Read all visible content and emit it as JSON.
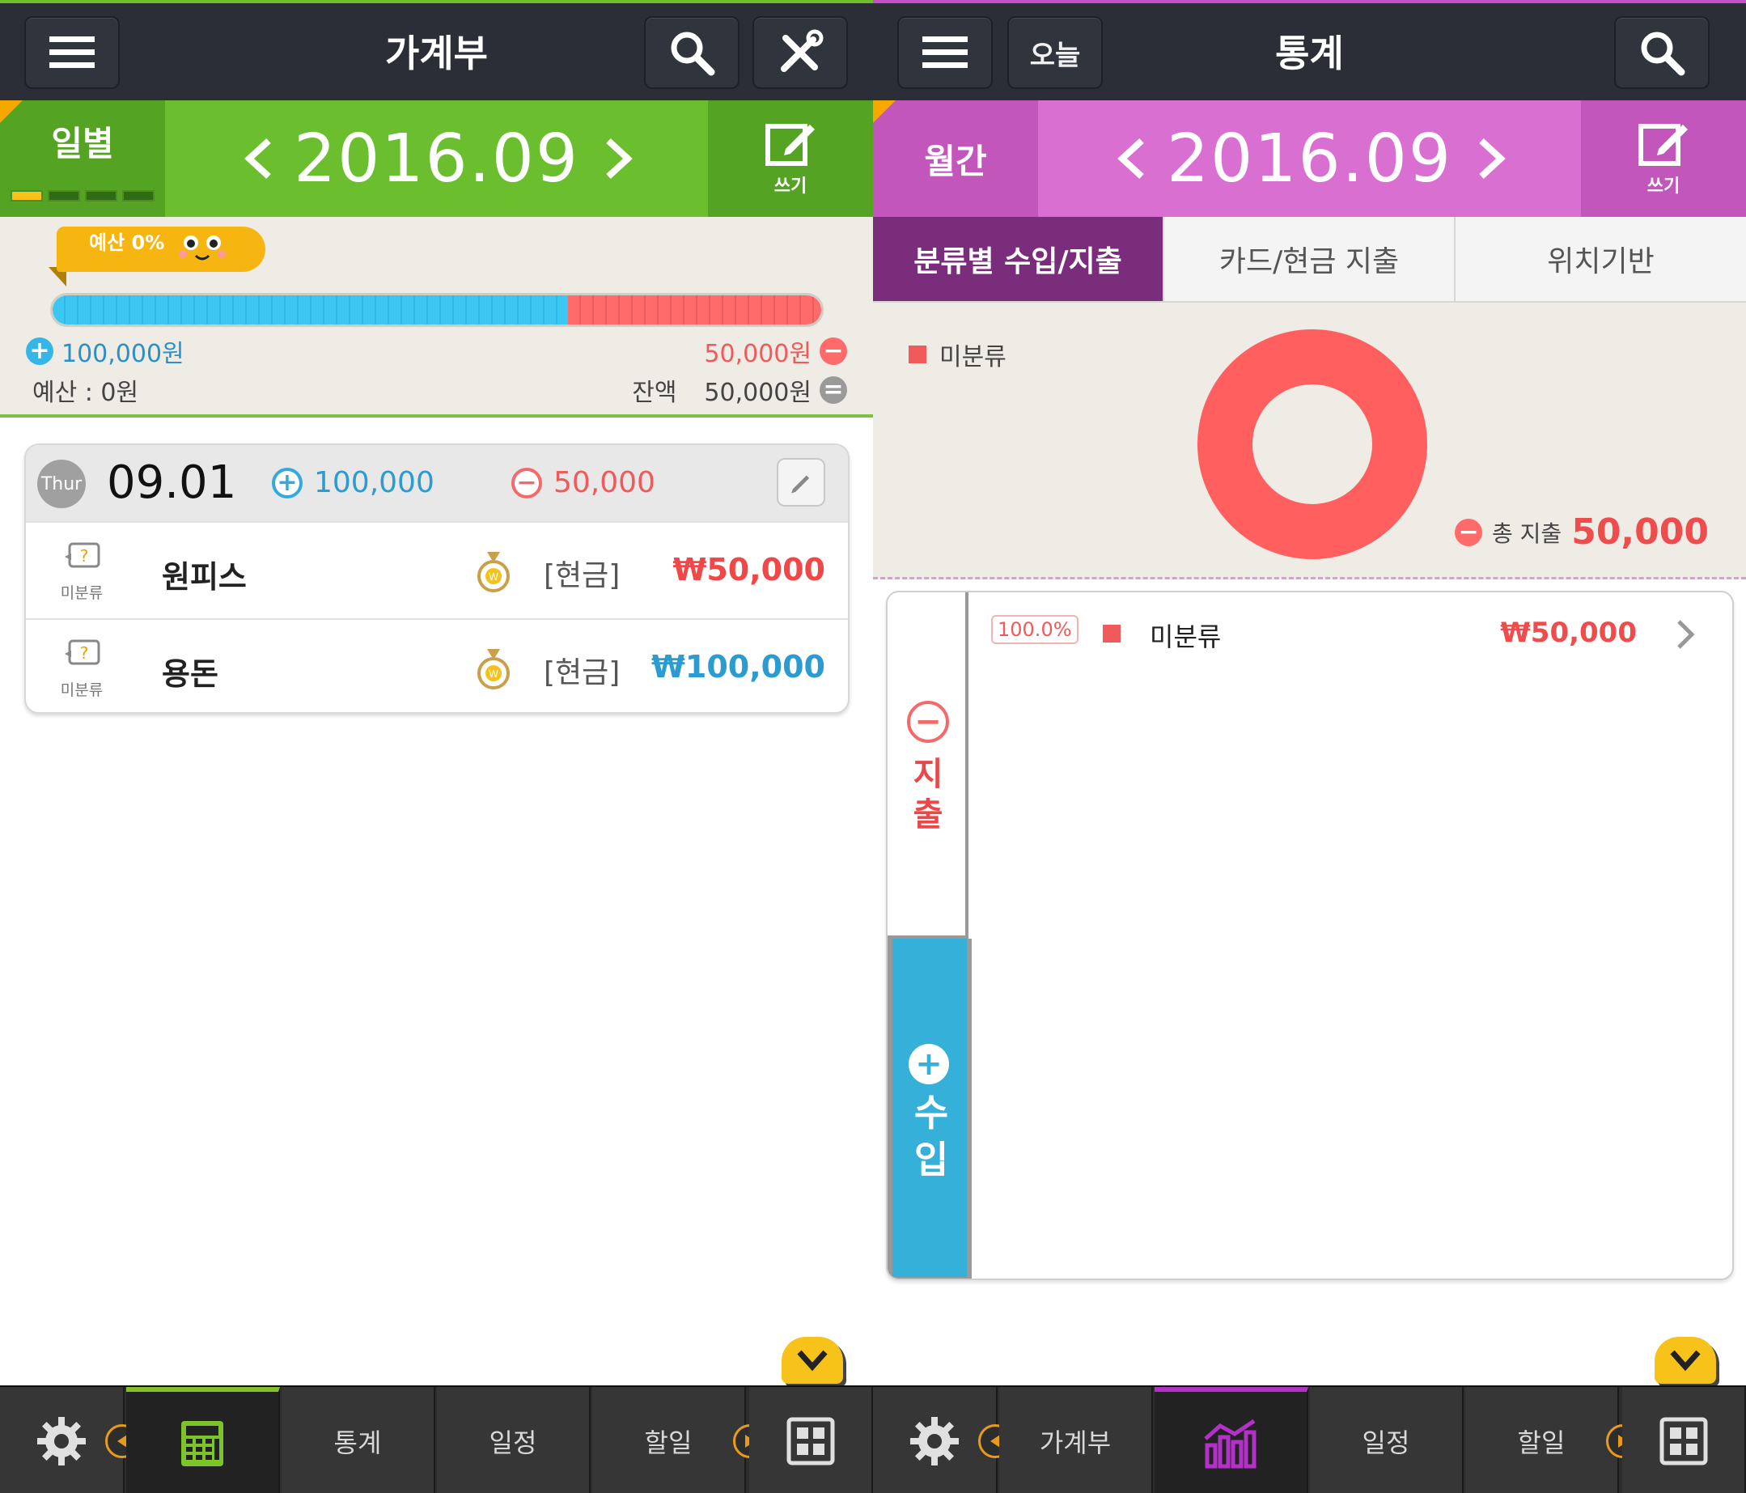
{
  "left": {
    "topbar": {
      "title": "가계부",
      "menu_icon": "menu-icon",
      "search_icon": "search-icon",
      "tools_icon": "tools-icon"
    },
    "monthbar": {
      "mode_label": "일별",
      "month": "2016.09",
      "write_label": "쓰기"
    },
    "budget": {
      "tag": "예산 0%",
      "income_fraction": 0.67,
      "income": "100,000원",
      "expense": "50,000원",
      "budget_label": "예산 : 0원",
      "balance_label": "잔액",
      "balance": "50,000원"
    },
    "day": {
      "weekday": "Thur",
      "date": "09.01",
      "income": "100,000",
      "expense": "50,000",
      "rows": [
        {
          "category": "미분류",
          "name": "원피스",
          "method": "[현금]",
          "amount": "₩50,000",
          "color": "#f04848"
        },
        {
          "category": "미분류",
          "name": "용돈",
          "method": "[현금]",
          "amount": "₩100,000",
          "color": "#2b9bd0"
        }
      ]
    },
    "nav": {
      "stats": "통계",
      "schedule": "일정",
      "todo": "할일"
    }
  },
  "right": {
    "topbar": {
      "title": "통계",
      "today": "오늘",
      "menu_icon": "menu-icon",
      "search_icon": "search-icon"
    },
    "monthbar": {
      "mode_label": "월간",
      "month": "2016.09",
      "write_label": "쓰기"
    },
    "tabs": [
      "분류별 수입/지출",
      "카드/현금 지출",
      "위치기반"
    ],
    "chart": {
      "legend": "미분류",
      "total_label": "총 지출",
      "total": "50,000"
    },
    "chart_data": {
      "type": "pie",
      "categories": [
        "미분류"
      ],
      "values": [
        50000
      ],
      "title": "",
      "colors": [
        "#ff5f5f"
      ]
    },
    "list": {
      "expense_label": "지출",
      "income_label": "수입",
      "rows": [
        {
          "pct": "100.0%",
          "name": "미분류",
          "amount": "₩50,000"
        }
      ]
    },
    "nav": {
      "ledger": "가계부",
      "schedule": "일정",
      "todo": "할일"
    }
  }
}
